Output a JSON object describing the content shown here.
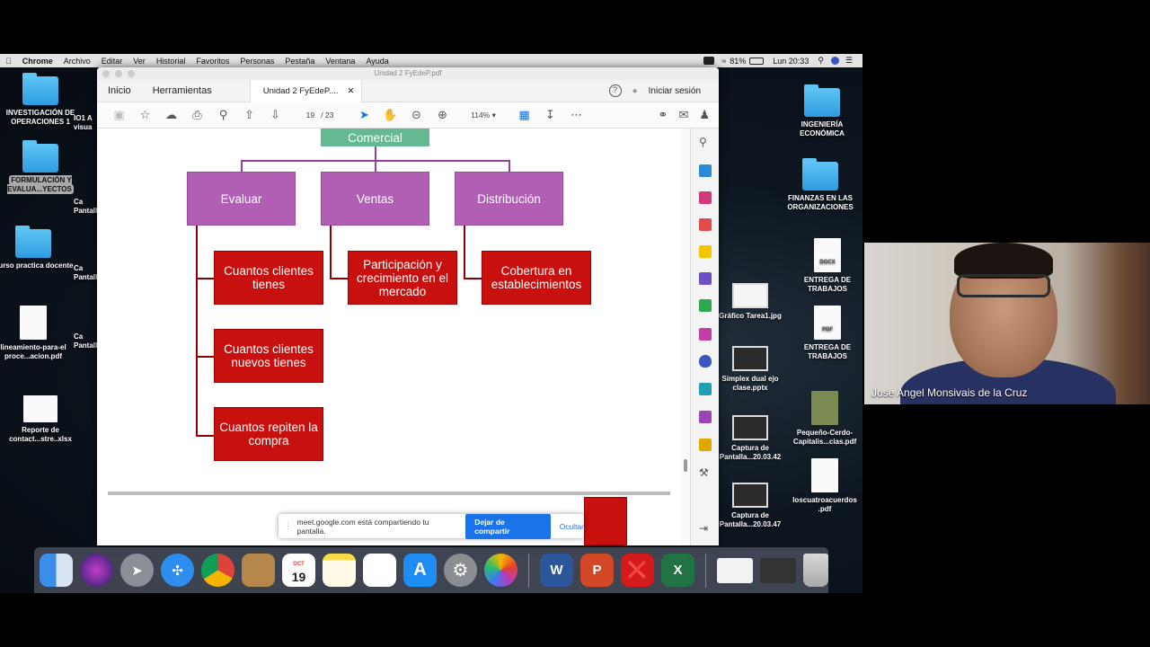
{
  "menubar": {
    "items": [
      "Chrome",
      "Archivo",
      "Editar",
      "Ver",
      "Historial",
      "Favoritos",
      "Personas",
      "Pestaña",
      "Ventana",
      "Ayuda"
    ],
    "battery": "81%",
    "clock": "Lun 20:33"
  },
  "desktop_left": [
    {
      "label": "INVESTIGACIÓN DE OPERACIONES 1",
      "kind": "folder"
    },
    {
      "label": "FORMULACIÓN Y EVALUA...YECTOS",
      "kind": "folder"
    },
    {
      "label": "Curso practica docente",
      "kind": "folder"
    },
    {
      "label": "lineamiento-para-el proce...acion.pdf",
      "kind": "doc"
    },
    {
      "label": "Reporte de contact...stre..xlsx",
      "kind": "doc"
    }
  ],
  "desktop_partial": [
    "IO1 A visua",
    "Ca Pantall",
    "Ca Pantall",
    "Ca Pantall"
  ],
  "desktop_right": [
    {
      "label": "INGENIERÍA ECONÓMICA",
      "kind": "folder"
    },
    {
      "label": "FINANZAS EN LAS ORGANIZACIONES",
      "kind": "folder"
    },
    {
      "label": "ENTREGA DE TRABAJOS",
      "kind": "doc",
      "badge": "DOCX"
    },
    {
      "label": "ENTREGA DE TRABAJOS",
      "kind": "doc",
      "badge": "PDF"
    },
    {
      "label": "Pequeño-Cerdo-Capitalis...cias.pdf",
      "kind": "doc"
    },
    {
      "label": "loscuatroacuerdos .pdf",
      "kind": "doc"
    }
  ],
  "desktop_mid": [
    {
      "label": "Gráfico Tarea1.jpg"
    },
    {
      "label": "Simplex dual ejo clase.pptx"
    },
    {
      "label": "Captura de Pantalla...20.03.42"
    },
    {
      "label": "Captura de Pantalla...20.03.47"
    }
  ],
  "acrobat": {
    "window_title": "Unidad 2 FyEdeP.pdf",
    "tabs": {
      "home": "Inicio",
      "tools": "Herramientas",
      "doc": "Unidad 2 FyEdeP...."
    },
    "help": "?",
    "signin": "Iniciar sesión",
    "page_current": "19",
    "page_total": "/ 23",
    "zoom": "114%"
  },
  "diagram": {
    "root": "Comercial",
    "level1": [
      "Evaluar",
      "Ventas",
      "Distribución"
    ],
    "evaluar_children": [
      "Cuantos clientes tienes",
      "Cuantos clientes nuevos tienes",
      "Cuantos repiten la compra"
    ],
    "ventas_children": [
      "Participación y crecimiento en el mercado"
    ],
    "distribucion_children": [
      "Cobertura en establecimientos"
    ]
  },
  "sharebar": {
    "text": "meet.google.com está compartiendo tu pantalla.",
    "stop": "Dejar de compartir",
    "hide": "Ocultar"
  },
  "dock": {
    "calendar_month": "OCT",
    "calendar_day": "19",
    "word": "W",
    "powerpoint": "P",
    "excel": "X"
  },
  "webcam": {
    "name": "Jose Angel Monsivais de la Cruz"
  }
}
